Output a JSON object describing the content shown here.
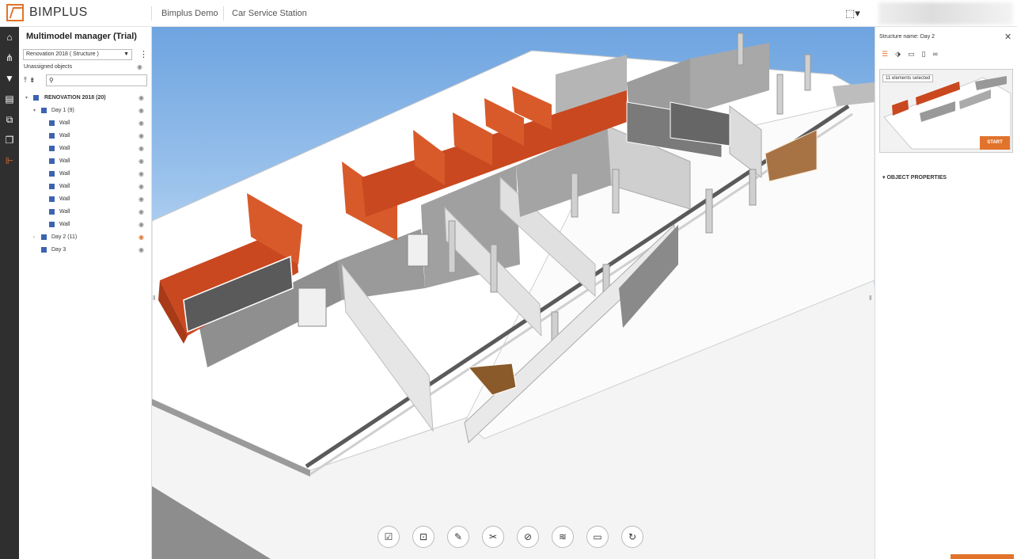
{
  "app": {
    "logo_text": "BIMPLUS"
  },
  "breadcrumb": {
    "project": "Bimplus Demo",
    "model": "Car Service Station"
  },
  "rail": {
    "icons": [
      "home-icon",
      "hierarchy-icon",
      "filter-icon",
      "clipboard-icon",
      "layers-icon",
      "copy-icon",
      "structure-icon"
    ]
  },
  "panel": {
    "title": "Multimodel manager (Trial)",
    "structure_select": "Renovation 2018 ( Structure )",
    "unassigned_label": "Unassigned objects",
    "tree": {
      "root": {
        "label": "RENOVATION 2018",
        "count": "(20)"
      },
      "day1": {
        "label": "Day 1",
        "count": "(9)"
      },
      "walls": [
        "Wall",
        "Wall",
        "Wall",
        "Wall",
        "Wall",
        "Wall",
        "Wall",
        "Wall",
        "Wall"
      ],
      "day2": {
        "label": "Day 2",
        "count": "(11)"
      },
      "day3": {
        "label": "Day 3"
      }
    }
  },
  "right_panel": {
    "title": "Structure name: Day 2",
    "selection_label": "11 elements selected",
    "start_label": "START",
    "object_properties_label": "OBJECT PROPERTIES"
  },
  "toolbar": {
    "tools": [
      "clipboard-check-icon",
      "crop-icon",
      "ruler-icon",
      "scissors-icon",
      "hide-icon",
      "layers-icon",
      "camera-icon",
      "refresh-icon"
    ]
  },
  "colors": {
    "accent": "#e1732b",
    "tree_square": "#3d63b0",
    "rail": "#2f2f2f",
    "highlight_wall": "#c9481f"
  }
}
